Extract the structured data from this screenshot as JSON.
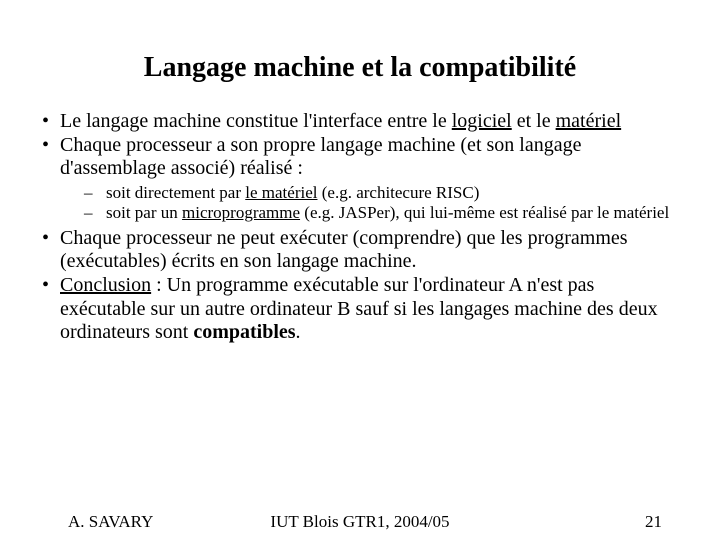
{
  "title": "Langage machine et la compatibilité",
  "b1_a": "Le langage machine constitue l'interface entre le ",
  "b1_b": "logiciel",
  "b1_c": " et le ",
  "b1_d": "matériel",
  "b2": "Chaque processeur a son propre langage machine (et son langage d'assemblage associé) réalisé :",
  "s1_a": "soit directement par ",
  "s1_b": "le matériel",
  "s1_c": " (e.g. architecure RISC)",
  "s2_a": "soit par un ",
  "s2_b": "microprogramme",
  "s2_c": " (e.g. JASPer), qui lui-même est réalisé par le matériel",
  "b3": "Chaque processeur ne peut exécuter (comprendre) que les programmes (exécutables) écrits en son langage machine.",
  "b4_a": "Conclusion",
  "b4_b": " : Un programme exécutable sur l'ordinateur A n'est pas exécutable sur un autre ordinateur B sauf si les langages machine des deux ordinateurs sont ",
  "b4_c": "compatibles",
  "b4_d": ".",
  "footer": {
    "author": "A. SAVARY",
    "inst": "IUT Blois GTR1, 2004/05",
    "page": "21"
  }
}
